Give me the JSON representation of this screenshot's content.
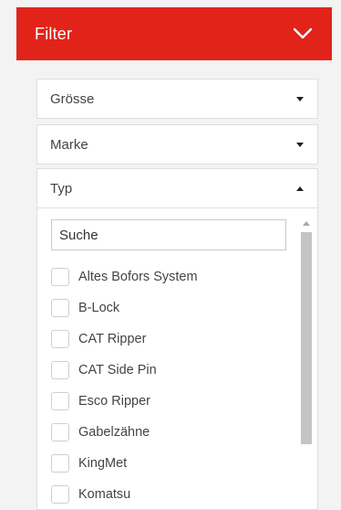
{
  "filter": {
    "title": "Filter",
    "header_bg": "#e2231a",
    "toggle_icon": "chevron-down-icon"
  },
  "dropdowns": [
    {
      "label": "Grösse",
      "expanded": false
    },
    {
      "label": "Marke",
      "expanded": false
    },
    {
      "label": "Typ",
      "expanded": true
    }
  ],
  "typ_panel": {
    "search_placeholder": "Suche",
    "options": [
      {
        "label": "Altes Bofors System",
        "checked": false
      },
      {
        "label": "B-Lock",
        "checked": false
      },
      {
        "label": "CAT Ripper",
        "checked": false
      },
      {
        "label": "CAT Side Pin",
        "checked": false
      },
      {
        "label": "Esco Ripper",
        "checked": false
      },
      {
        "label": "Gabelzähne",
        "checked": false
      },
      {
        "label": "KingMet",
        "checked": false
      },
      {
        "label": "Komatsu",
        "checked": false
      }
    ]
  }
}
